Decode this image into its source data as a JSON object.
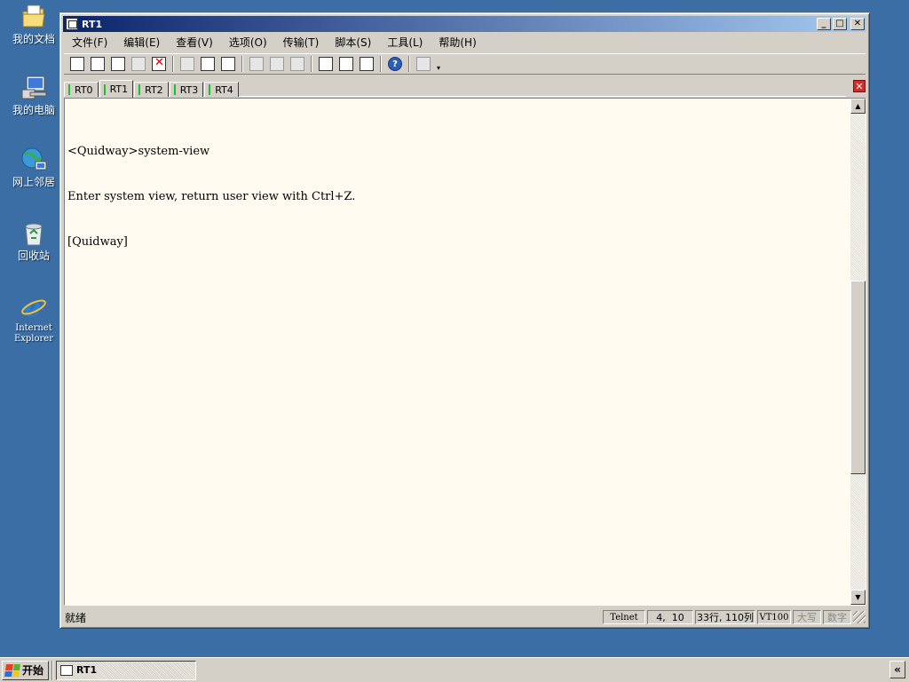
{
  "desktop": {
    "icons": [
      {
        "label": "我的文档",
        "icon": "folder-documents-icon"
      },
      {
        "label": "我的电脑",
        "icon": "computer-icon"
      },
      {
        "label": "网上邻居",
        "icon": "network-places-icon"
      },
      {
        "label": "回收站",
        "icon": "recycle-bin-icon"
      },
      {
        "label": "Internet Explorer",
        "icon": "internet-explorer-icon"
      }
    ]
  },
  "window": {
    "title": "RT1",
    "controls": {
      "minimize": "_",
      "maximize": "□",
      "close": "✕"
    }
  },
  "menubar": {
    "items": [
      "文件(F)",
      "编辑(E)",
      "查看(V)",
      "选项(O)",
      "传输(T)",
      "脚本(S)",
      "工具(L)",
      "帮助(H)"
    ]
  },
  "toolbar": {
    "help_glyph": "?"
  },
  "tabs": {
    "items": [
      "RT0",
      "RT1",
      "RT2",
      "RT3",
      "RT4"
    ],
    "active": "RT1",
    "close_glyph": "✕"
  },
  "terminal": {
    "lines": [
      "<Quidway>system-view",
      "Enter system view, return user view with Ctrl+Z.",
      "[Quidway]"
    ],
    "scroll_position": 0.59
  },
  "statusbar": {
    "ready": "就绪",
    "protocol": "Telnet",
    "cursor": "4,  10",
    "size": "33行, 110列",
    "emulation": "VT100",
    "caps": "大写",
    "num": "数字"
  },
  "taskbar": {
    "start_label": "开始",
    "task_label": "RT1",
    "tray_toggle": "«"
  },
  "colors": {
    "desktop": "#3a6ea5",
    "titlebar_start": "#0a246a",
    "titlebar_end": "#a6caf0",
    "terminal_bg": "#fffbf0",
    "tab_indicator": "#1fbf2b",
    "close_tab": "#d12b2b"
  }
}
